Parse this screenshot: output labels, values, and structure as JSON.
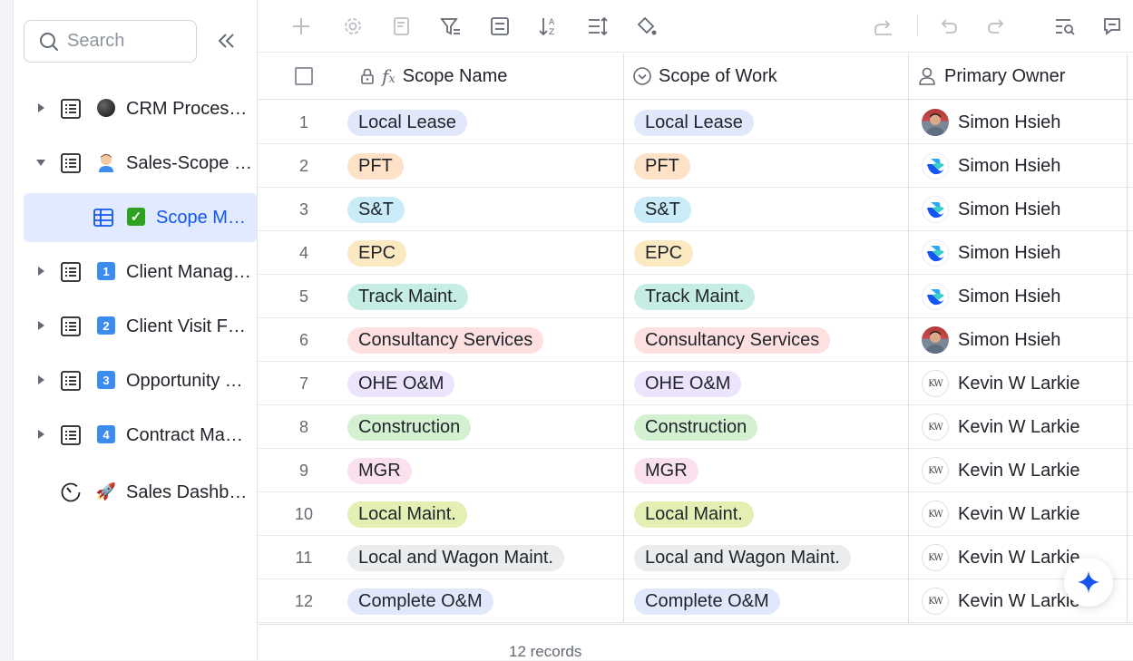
{
  "sidebar": {
    "search_placeholder": "Search",
    "items": [
      {
        "label": "CRM Process Overview",
        "icon": "table-icon",
        "emoji": "black-circle",
        "expandable": true,
        "expanded": false
      },
      {
        "label": "Sales-Scope Manager",
        "icon": "table-icon",
        "emoji": "person-emoji",
        "expandable": true,
        "expanded": true
      },
      {
        "label": "Scope Master",
        "icon": "grid-icon",
        "emoji": "check-box-emoji",
        "active": true
      },
      {
        "label": "Client Management",
        "icon": "table-icon",
        "emoji": "1",
        "expandable": true
      },
      {
        "label": "Client Visit Form",
        "icon": "table-icon",
        "emoji": "2",
        "expandable": true
      },
      {
        "label": "Opportunity Tracker",
        "icon": "table-icon",
        "emoji": "3",
        "expandable": true
      },
      {
        "label": "Contract Management",
        "icon": "table-icon",
        "emoji": "4",
        "expandable": true
      },
      {
        "label": "Sales Dashboard",
        "icon": "dashboard-icon",
        "emoji": "rocket-emoji"
      }
    ]
  },
  "grid": {
    "headers": {
      "scope_name": "Scope Name",
      "scope_of_work": "Scope of Work",
      "primary_owner": "Primary Owner"
    },
    "rows": [
      {
        "n": "1",
        "name": "Local Lease",
        "work": "Local Lease",
        "owner": "Simon Hsieh",
        "avatar": "photo",
        "color": "#e1e8fb"
      },
      {
        "n": "2",
        "name": "PFT",
        "work": "PFT",
        "owner": "Simon Hsieh",
        "avatar": "lark",
        "color": "#fde2c8"
      },
      {
        "n": "3",
        "name": "S&T",
        "work": "S&T",
        "owner": "Simon Hsieh",
        "avatar": "lark",
        "color": "#c9ecf8"
      },
      {
        "n": "4",
        "name": "EPC",
        "work": "EPC",
        "owner": "Simon Hsieh",
        "avatar": "lark",
        "color": "#fbe9c2"
      },
      {
        "n": "5",
        "name": "Track Maint.",
        "work": "Track Maint.",
        "owner": "Simon Hsieh",
        "avatar": "lark",
        "color": "#c5ede3"
      },
      {
        "n": "6",
        "name": "Consultancy Services",
        "work": "Consultancy Services",
        "owner": "Simon Hsieh",
        "avatar": "photo",
        "color": "#fde0df"
      },
      {
        "n": "7",
        "name": "OHE O&M",
        "work": "OHE O&M",
        "owner": "Kevin W Larkie",
        "avatar": "kw",
        "color": "#ece4fc"
      },
      {
        "n": "8",
        "name": "Construction",
        "work": "Construction",
        "owner": "Kevin W Larkie",
        "avatar": "kw",
        "color": "#d3f1d0"
      },
      {
        "n": "9",
        "name": "MGR",
        "work": "MGR",
        "owner": "Kevin W Larkie",
        "avatar": "kw",
        "color": "#fbe1ef"
      },
      {
        "n": "10",
        "name": "Local Maint.",
        "work": "Local Maint.",
        "owner": "Kevin W Larkie",
        "avatar": "kw",
        "color": "#e4efb3"
      },
      {
        "n": "11",
        "name": "Local and Wagon Maint.",
        "work": "Local and Wagon Maint.",
        "owner": "Kevin W Larkie",
        "avatar": "kw",
        "color": "#ebecee"
      },
      {
        "n": "12",
        "name": "Complete O&M",
        "work": "Complete O&M",
        "owner": "Kevin W Larkie",
        "avatar": "kw",
        "color": "#e1e8fb"
      }
    ]
  },
  "footer": {
    "records": "12 records"
  },
  "colors": {
    "accent": "#1456f0",
    "active_bg": "#e1eaff"
  }
}
